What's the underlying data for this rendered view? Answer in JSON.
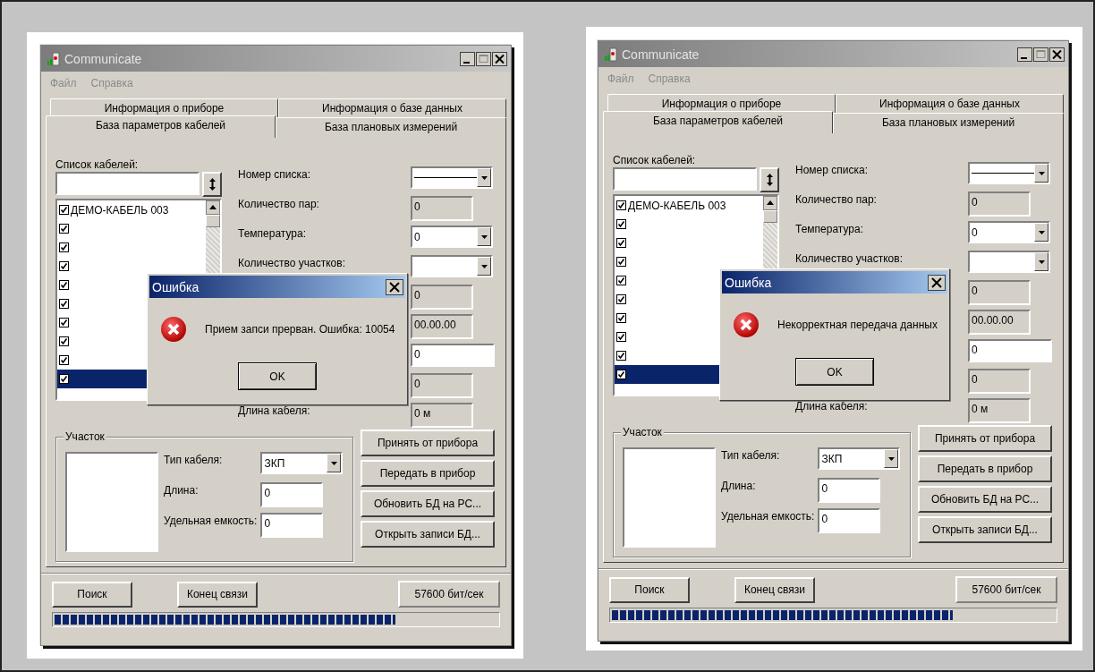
{
  "windows": [
    {
      "title": "Communicate",
      "menu": [
        {
          "label": "Файл",
          "disabled": true
        },
        {
          "label": "Справка",
          "disabled": true
        }
      ],
      "tab_rows": [
        [
          {
            "label": "Информация о приборе",
            "selected": false
          },
          {
            "label": "Информация о базе данных",
            "selected": false
          }
        ],
        [
          {
            "label": "База параметров кабелей",
            "selected": true
          },
          {
            "label": "База плановых измерений",
            "selected": false
          }
        ]
      ],
      "cable_list": {
        "label": "Список кабелей:",
        "items": [
          {
            "label": "ДЕМО-КАБЕЛЬ  003",
            "checked": true,
            "selected": false
          },
          {
            "checked": true,
            "selected": false
          },
          {
            "checked": true,
            "selected": false
          },
          {
            "checked": true,
            "selected": false
          },
          {
            "checked": true,
            "selected": false
          },
          {
            "checked": true,
            "selected": false
          },
          {
            "checked": true,
            "selected": false
          },
          {
            "checked": true,
            "selected": false
          },
          {
            "checked": true,
            "selected": false
          },
          {
            "checked": true,
            "selected": true
          }
        ]
      },
      "fields": [
        {
          "label": "Номер списка:",
          "kind": "line-combo"
        },
        {
          "label": "Количество пар:",
          "kind": "readonly",
          "value": "0"
        },
        {
          "label": "Температура:",
          "kind": "combo",
          "value": "0"
        },
        {
          "label": "Количество участков:",
          "kind": "combo"
        },
        {
          "kind": "readonly",
          "value": "0"
        },
        {
          "kind": "readonly",
          "value": "00.00.00"
        },
        {
          "kind": "edit",
          "value": "0"
        },
        {
          "kind": "readonly",
          "value": "0"
        },
        {
          "label": "Длина кабеля:",
          "kind": "readonly",
          "value": "0 м"
        }
      ],
      "section": {
        "title": "Участок",
        "fields": [
          {
            "label": "Тип кабеля:",
            "kind": "combo",
            "value": "ЗКП"
          },
          {
            "label": "Длина:",
            "kind": "edit",
            "value": "0"
          },
          {
            "label": "Удельная емкость:",
            "kind": "edit",
            "value": "0"
          }
        ]
      },
      "actions": [
        "Принять от прибора",
        "Передать в прибор",
        "Обновить БД на РС...",
        "Открыть записи БД..."
      ],
      "footer_buttons": [
        "Поиск",
        "Конец связи"
      ],
      "speed": "57600 бит/сек",
      "progress": {
        "level": 0.77
      },
      "dialog": {
        "title": "Ошибка",
        "message": "Прием запси прерван. Ошибка:  10054",
        "button": "OK"
      }
    },
    {
      "title": "Communicate",
      "menu": [
        {
          "label": "Файл",
          "disabled": true
        },
        {
          "label": "Справка",
          "disabled": true
        }
      ],
      "tab_rows": [
        [
          {
            "label": "Информация о приборе",
            "selected": false
          },
          {
            "label": "Информация о базе данных",
            "selected": false
          }
        ],
        [
          {
            "label": "База параметров кабелей",
            "selected": true
          },
          {
            "label": "База плановых измерений",
            "selected": false
          }
        ]
      ],
      "cable_list": {
        "label": "Список кабелей:",
        "items": [
          {
            "label": "ДЕМО-КАБЕЛЬ  003",
            "checked": true,
            "selected": false
          },
          {
            "checked": true,
            "selected": false
          },
          {
            "checked": true,
            "selected": false
          },
          {
            "checked": true,
            "selected": false
          },
          {
            "checked": true,
            "selected": false
          },
          {
            "checked": true,
            "selected": false
          },
          {
            "checked": true,
            "selected": false
          },
          {
            "checked": true,
            "selected": false
          },
          {
            "checked": true,
            "selected": false
          },
          {
            "checked": true,
            "selected": true
          }
        ]
      },
      "fields": [
        {
          "label": "Номер списка:",
          "kind": "line-combo"
        },
        {
          "label": "Количество пар:",
          "kind": "readonly",
          "value": "0"
        },
        {
          "label": "Температура:",
          "kind": "combo",
          "value": "0"
        },
        {
          "label": "Количество участков:",
          "kind": "combo"
        },
        {
          "kind": "readonly",
          "value": "0"
        },
        {
          "kind": "readonly",
          "value": "00.00.00"
        },
        {
          "kind": "edit",
          "value": "0"
        },
        {
          "kind": "readonly",
          "value": "0"
        },
        {
          "label": "Длина кабеля:",
          "kind": "readonly",
          "value": "0 м"
        }
      ],
      "section": {
        "title": "Участок",
        "fields": [
          {
            "label": "Тип кабеля:",
            "kind": "combo",
            "value": "ЗКП"
          },
          {
            "label": "Длина:",
            "kind": "edit",
            "value": "0"
          },
          {
            "label": "Удельная емкость:",
            "kind": "edit",
            "value": "0"
          }
        ]
      },
      "actions": [
        "Принять от прибора",
        "Передать в прибор",
        "Обновить БД на РС...",
        "Открыть записи БД..."
      ],
      "footer_buttons": [
        "Поиск",
        "Конец связи"
      ],
      "speed": "57600 бит/сек",
      "progress": {
        "level": 0.77
      },
      "dialog": {
        "title": "Ошибка",
        "message": "Некорректная передача данных",
        "button": "OK"
      }
    }
  ]
}
